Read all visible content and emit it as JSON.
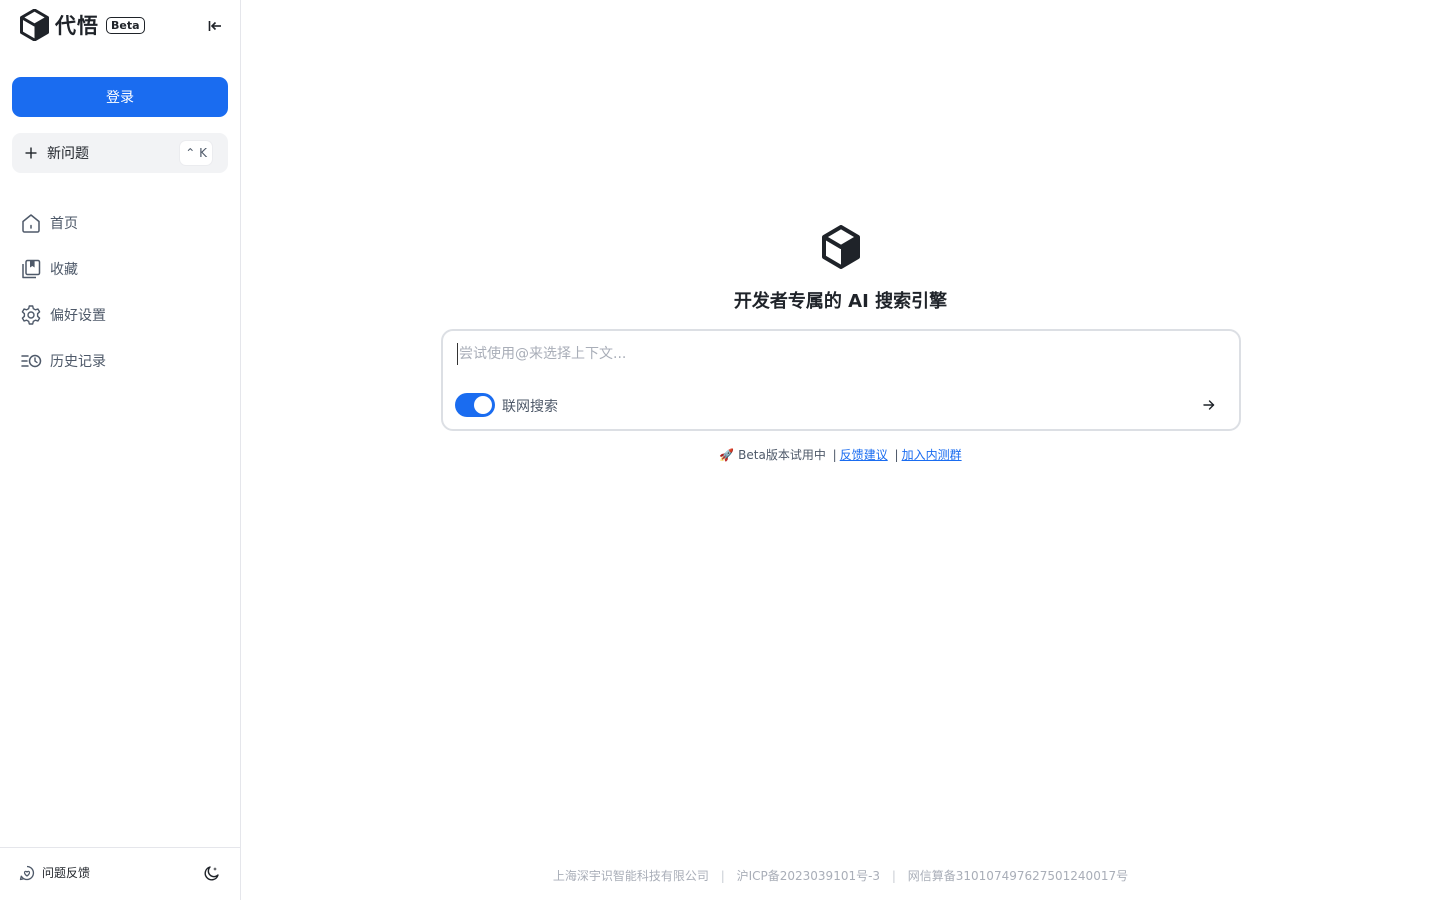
{
  "sidebar": {
    "brand": {
      "name": "代悟",
      "badge": "Beta"
    },
    "login_label": "登录",
    "new_question": {
      "label": "新问题",
      "shortcut": "⌃ K"
    },
    "nav": [
      {
        "label": "首页",
        "icon": "home-icon"
      },
      {
        "label": "收藏",
        "icon": "collection-icon"
      },
      {
        "label": "偏好设置",
        "icon": "gear-icon"
      },
      {
        "label": "历史记录",
        "icon": "history-icon"
      }
    ],
    "footer": {
      "feedback_label": "问题反馈"
    }
  },
  "main": {
    "headline": "开发者专属的 AI 搜索引擎",
    "search": {
      "placeholder": "尝试使用@来选择上下文...",
      "value": "",
      "web_search_label": "联网搜索",
      "web_search_enabled": true
    },
    "notice": {
      "emoji": "🚀",
      "text": " Beta版本试用中",
      "separator": "|",
      "feedback_link": "反馈建议",
      "group_link": "加入内测群"
    },
    "footer": {
      "company": "上海深宇识智能科技有限公司",
      "icp": "沪ICP备2023039101号-3",
      "algorithm": "网信算备310107497627501240017号",
      "divider": "|"
    }
  },
  "colors": {
    "accent": "#1a6cf0",
    "text": "#1f2329",
    "muted": "#a9aeb8",
    "border": "#e5e6eb"
  }
}
